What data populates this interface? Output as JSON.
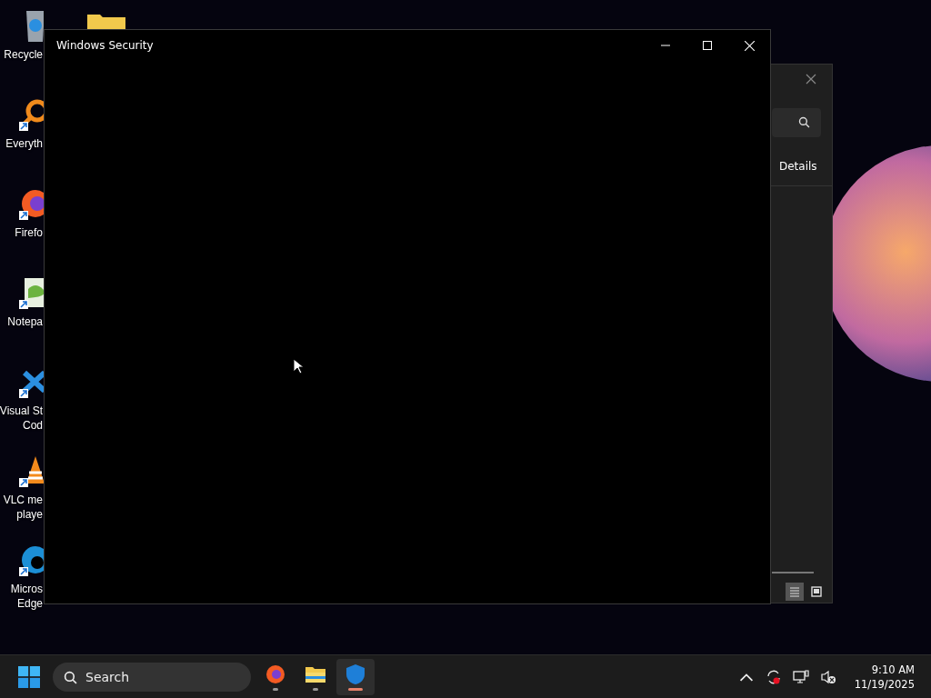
{
  "desktop_icons": [
    {
      "kind": "recycle",
      "lines": [
        "Recycle"
      ]
    },
    {
      "kind": "search",
      "lines": [
        "Everyth"
      ],
      "shortcut": true
    },
    {
      "kind": "firefox",
      "lines": [
        "Firefo"
      ],
      "shortcut": true
    },
    {
      "kind": "notepad",
      "lines": [
        "Notepa"
      ],
      "shortcut": true
    },
    {
      "kind": "vscode",
      "lines": [
        "Visual St",
        "Cod"
      ],
      "shortcut": true
    },
    {
      "kind": "vlc",
      "lines": [
        "VLC me",
        "playe"
      ],
      "shortcut": true
    },
    {
      "kind": "edge",
      "lines": [
        "Micros",
        "Edge"
      ],
      "shortcut": true
    }
  ],
  "background_window": {
    "tab": "Details",
    "views": [
      {
        "kind": "list",
        "selected": true
      },
      {
        "kind": "thumbnails",
        "selected": false
      }
    ]
  },
  "window": {
    "title": "Windows Security"
  },
  "taskbar": {
    "search": {
      "placeholder": "Search"
    },
    "apps": [
      {
        "kind": "firefox",
        "selected": false
      },
      {
        "kind": "explorer",
        "selected": false
      },
      {
        "kind": "shield",
        "selected": true
      }
    ],
    "time": "9:10 AM",
    "date": "11/19/2025"
  }
}
